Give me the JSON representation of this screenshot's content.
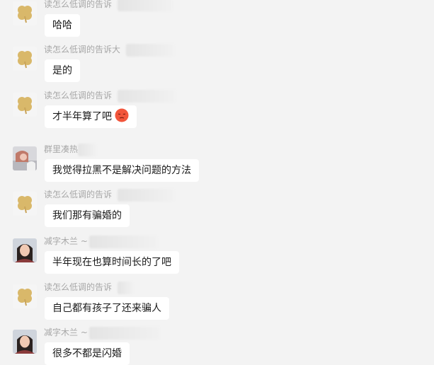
{
  "messages": [
    {
      "sender": "读怎么低调的告诉",
      "text": "哈哈",
      "avatar": "clover"
    },
    {
      "sender": "读怎么低调的告诉大",
      "text": "是的",
      "avatar": "clover"
    },
    {
      "sender": "读怎么低调的告诉",
      "text": "才半年算了吧",
      "avatar": "clover",
      "emoji": "pensive-face-icon"
    },
    {
      "sender": "群里凑热",
      "text": "我觉得拉黑不是解决问题的方法",
      "avatar": "photo-girl"
    },
    {
      "sender": "读怎么低调的告诉",
      "text": "我们那有骗婚的",
      "avatar": "clover"
    },
    {
      "sender": "减字木兰 ~",
      "text": "半年现在也算时间长的了吧",
      "avatar": "photo-woman"
    },
    {
      "sender": "读怎么低调的告诉",
      "text": "自己都有孩子了还来骗人",
      "avatar": "clover"
    },
    {
      "sender": "减字木兰 ~",
      "text": "很多不都是闪婚",
      "avatar": "photo-woman"
    }
  ],
  "colors": {
    "background": "#f3f3f3",
    "bubble": "#ffffff",
    "sender_name": "#a7a7a7",
    "text": "#1a1a1a",
    "clover": "#d9b86a"
  }
}
